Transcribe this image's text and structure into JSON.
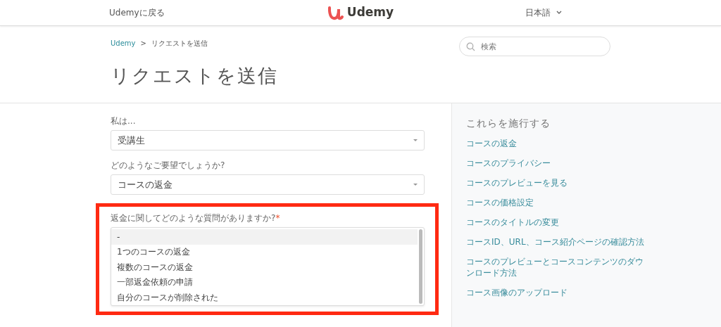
{
  "header": {
    "back_link": "Udemyに戻る",
    "logo_text": "Udemy",
    "language": "日本語"
  },
  "breadcrumb": [
    {
      "label": "Udemy",
      "kind": "link"
    },
    {
      "label": "リクエストを送信",
      "kind": "current"
    }
  ],
  "breadcrumb_separator": ">",
  "search": {
    "placeholder": "検索"
  },
  "page_title": "リクエストを送信",
  "form": {
    "fields": [
      {
        "kind": "select",
        "label": "私は...",
        "value": "受講生",
        "highlighted": false
      },
      {
        "kind": "select",
        "label": "どのようなご要望でしょうか?",
        "value": "コースの返金",
        "highlighted": false
      },
      {
        "kind": "listbox",
        "label": "返金に関してどのような質問がありますか?",
        "required_mark": "*",
        "highlighted": true,
        "options": [
          {
            "label": "-",
            "selected": true
          },
          {
            "label": "1つのコースの返金",
            "selected": false
          },
          {
            "label": "複数のコースの返金",
            "selected": false
          },
          {
            "label": "一部返金依頼の申請",
            "selected": false
          },
          {
            "label": "自分のコースが削除された",
            "selected": false
          }
        ]
      }
    ]
  },
  "sidebar": {
    "title": "これらを施行する",
    "items": [
      "コースの返金",
      "コースのプライバシー",
      "コースのプレビューを見る",
      "コースの価格設定",
      "コースのタイトルの変更",
      "コースID、URL、コース紹介ページの確認方法",
      "コースのプレビューとコースコンテンツのダウンロード方法",
      "コース画像のアップロード"
    ]
  }
}
